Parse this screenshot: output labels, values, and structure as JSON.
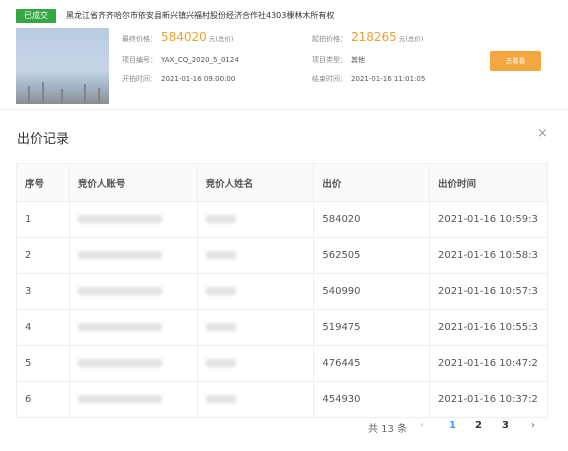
{
  "auction": {
    "status": "已成交",
    "title": "黑龙江省齐齐哈尔市依安县新兴镇兴福村股份经济合作社4303棵林木所有权",
    "deal_price_label": "最终价格：",
    "deal_price": "584020",
    "price_unit": "元(总价)",
    "start_price_label": "起拍价格：",
    "start_price": "218265",
    "project_no_label": "项目编号：",
    "project_no": "YAX_CQ_2020_5_0124",
    "category_label": "项目类型：",
    "category": "其他",
    "start_time_label": "开拍时间：",
    "start_time": "2021-01-16 09:00:00",
    "end_time_label": "结束时间：",
    "end_time": "2021-01-16 11:01:05",
    "watch_button": "去看看"
  },
  "dialog": {
    "title": "出价记录",
    "close": "×",
    "headers": [
      "序号",
      "竞价人账号",
      "竞价人姓名",
      "出价",
      "出价时间"
    ],
    "rows": [
      {
        "no": "1",
        "price": "584020",
        "time": "2021-01-16 10:59:3"
      },
      {
        "no": "2",
        "price": "562505",
        "time": "2021-01-16 10:58:3"
      },
      {
        "no": "3",
        "price": "540990",
        "time": "2021-01-16 10:57:3"
      },
      {
        "no": "4",
        "price": "519475",
        "time": "2021-01-16 10:55:3"
      },
      {
        "no": "5",
        "price": "476445",
        "time": "2021-01-16 10:47:2"
      },
      {
        "no": "6",
        "price": "454930",
        "time": "2021-01-16 10:37:2"
      }
    ]
  },
  "pagination": {
    "total": "共 13 条",
    "prev": "‹",
    "pages": [
      "1",
      "2",
      "3"
    ],
    "next": "›",
    "current_color": "#409eff"
  },
  "colors": {
    "status_badge": "#35a644",
    "price": "#f0a030",
    "button": "#f3a73f"
  }
}
